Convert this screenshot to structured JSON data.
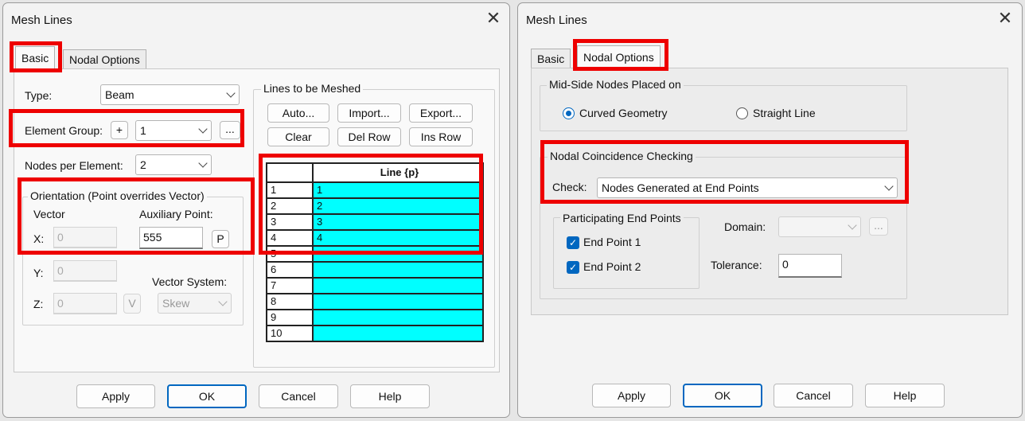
{
  "colors": {
    "accent": "#0067c0",
    "grid_cell": "#00ffff",
    "highlight": "#ee0000"
  },
  "left": {
    "title": "Mesh Lines",
    "tabs": [
      "Basic",
      "Nodal Options"
    ],
    "type_label": "Type:",
    "type_value": "Beam",
    "element_group_label": "Element Group:",
    "element_group_plus": "+",
    "element_group_value": "1",
    "element_group_more": "...",
    "nodes_label": "Nodes per Element:",
    "nodes_value": "2",
    "orientation_title": "Orientation (Point overrides Vector)",
    "vector_label": "Vector",
    "aux_label": "Auxiliary Point:",
    "x_label": "X:",
    "x_value": "0",
    "aux_value": "555",
    "p_button": "P",
    "y_label": "Y:",
    "y_value": "0",
    "vector_system_label": "Vector System:",
    "z_label": "Z:",
    "z_value": "0",
    "v_button": "V",
    "vector_system_value": "Skew",
    "lines_title": "Lines to be Meshed",
    "buttons": {
      "auto": "Auto...",
      "import": "Import...",
      "export": "Export...",
      "clear": "Clear",
      "del_row": "Del Row",
      "ins_row": "Ins Row"
    },
    "grid": {
      "header": "Line {p}",
      "rows": [
        {
          "num": "1",
          "val": "1"
        },
        {
          "num": "2",
          "val": "2"
        },
        {
          "num": "3",
          "val": "3"
        },
        {
          "num": "4",
          "val": "4"
        },
        {
          "num": "5",
          "val": ""
        },
        {
          "num": "6",
          "val": ""
        },
        {
          "num": "7",
          "val": ""
        },
        {
          "num": "8",
          "val": ""
        },
        {
          "num": "9",
          "val": ""
        },
        {
          "num": "10",
          "val": ""
        }
      ]
    },
    "footer": {
      "apply": "Apply",
      "ok": "OK",
      "cancel": "Cancel",
      "help": "Help"
    }
  },
  "right": {
    "title": "Mesh Lines",
    "tabs": [
      "Basic",
      "Nodal Options"
    ],
    "midside_title": "Mid-Side Nodes Placed on",
    "curved": "Curved Geometry",
    "straight": "Straight Line",
    "coincidence_title": "Nodal Coincidence Checking",
    "check_label": "Check:",
    "check_value": "Nodes Generated at End Points",
    "participating_title": "Participating End Points",
    "end1": "End Point 1",
    "end2": "End Point 2",
    "domain_label": "Domain:",
    "domain_more": "...",
    "tolerance_label": "Tolerance:",
    "tolerance_value": "0",
    "footer": {
      "apply": "Apply",
      "ok": "OK",
      "cancel": "Cancel",
      "help": "Help"
    }
  }
}
